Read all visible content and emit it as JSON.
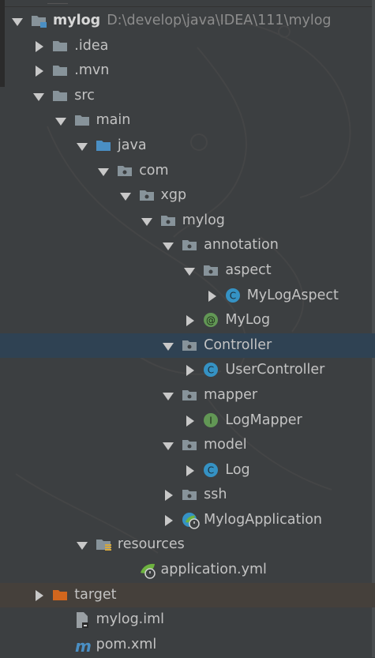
{
  "tree": [
    {
      "id": "mylog-root",
      "label": "mylog",
      "path": "D:\\develop\\java\\IDEA\\111\\mylog",
      "depth": 0,
      "arrow": "open",
      "icon": "module-folder",
      "bold": true
    },
    {
      "id": "idea",
      "label": ".idea",
      "depth": 1,
      "arrow": "closed",
      "icon": "folder"
    },
    {
      "id": "mvn",
      "label": ".mvn",
      "depth": 1,
      "arrow": "closed",
      "icon": "folder"
    },
    {
      "id": "src",
      "label": "src",
      "depth": 1,
      "arrow": "open",
      "icon": "folder"
    },
    {
      "id": "main",
      "label": "main",
      "depth": 2,
      "arrow": "open",
      "icon": "folder"
    },
    {
      "id": "java",
      "label": "java",
      "depth": 3,
      "arrow": "open",
      "icon": "source-folder"
    },
    {
      "id": "com",
      "label": "com",
      "depth": 4,
      "arrow": "open",
      "icon": "package"
    },
    {
      "id": "xgp",
      "label": "xgp",
      "depth": 5,
      "arrow": "open",
      "icon": "package"
    },
    {
      "id": "mylog-pkg",
      "label": "mylog",
      "depth": 6,
      "arrow": "open",
      "icon": "package"
    },
    {
      "id": "annotation",
      "label": "annotation",
      "depth": 7,
      "arrow": "open",
      "icon": "package"
    },
    {
      "id": "aspect",
      "label": "aspect",
      "depth": 8,
      "arrow": "open",
      "icon": "package"
    },
    {
      "id": "mylogaspect",
      "label": "MyLogAspect",
      "depth": 9,
      "arrow": "closed",
      "icon": "class"
    },
    {
      "id": "mylog-annotation",
      "label": "MyLog",
      "depth": 8,
      "arrow": "closed",
      "icon": "annotation"
    },
    {
      "id": "controller",
      "label": "Controller",
      "depth": 7,
      "arrow": "open",
      "icon": "package",
      "selected": true
    },
    {
      "id": "usercontroller",
      "label": "UserController",
      "depth": 8,
      "arrow": "closed",
      "icon": "class"
    },
    {
      "id": "mapper",
      "label": "mapper",
      "depth": 7,
      "arrow": "open",
      "icon": "package"
    },
    {
      "id": "logmapper",
      "label": "LogMapper",
      "depth": 8,
      "arrow": "closed",
      "icon": "interface"
    },
    {
      "id": "model",
      "label": "model",
      "depth": 7,
      "arrow": "open",
      "icon": "package"
    },
    {
      "id": "log",
      "label": "Log",
      "depth": 8,
      "arrow": "closed",
      "icon": "class"
    },
    {
      "id": "ssh",
      "label": "ssh",
      "depth": 7,
      "arrow": "closed",
      "icon": "package"
    },
    {
      "id": "mylogapplication",
      "label": "MylogApplication",
      "depth": 7,
      "arrow": "closed",
      "icon": "spring-boot-class"
    },
    {
      "id": "resources",
      "label": "resources",
      "depth": 3,
      "arrow": "open",
      "icon": "resources-folder"
    },
    {
      "id": "application-yml",
      "label": "application.yml",
      "depth": 5,
      "arrow": "none",
      "icon": "spring-yml"
    },
    {
      "id": "target",
      "label": "target",
      "depth": 1,
      "arrow": "closed",
      "icon": "excluded-folder",
      "excluded": true
    },
    {
      "id": "mylog-iml",
      "label": "mylog.iml",
      "depth": 2,
      "arrow": "none",
      "icon": "iml-file"
    },
    {
      "id": "pom-xml",
      "label": "pom.xml",
      "depth": 2,
      "arrow": "none",
      "icon": "maven-file"
    }
  ],
  "colors": {
    "background": "#3c3f41",
    "selected_row": "#2f4253",
    "folder": "#87939a",
    "source_folder": "#4a8fc4",
    "excluded_folder": "#d2661d",
    "class_icon": "#3592c4",
    "interface_icon": "#629755",
    "annotation_icon": "#629755"
  }
}
